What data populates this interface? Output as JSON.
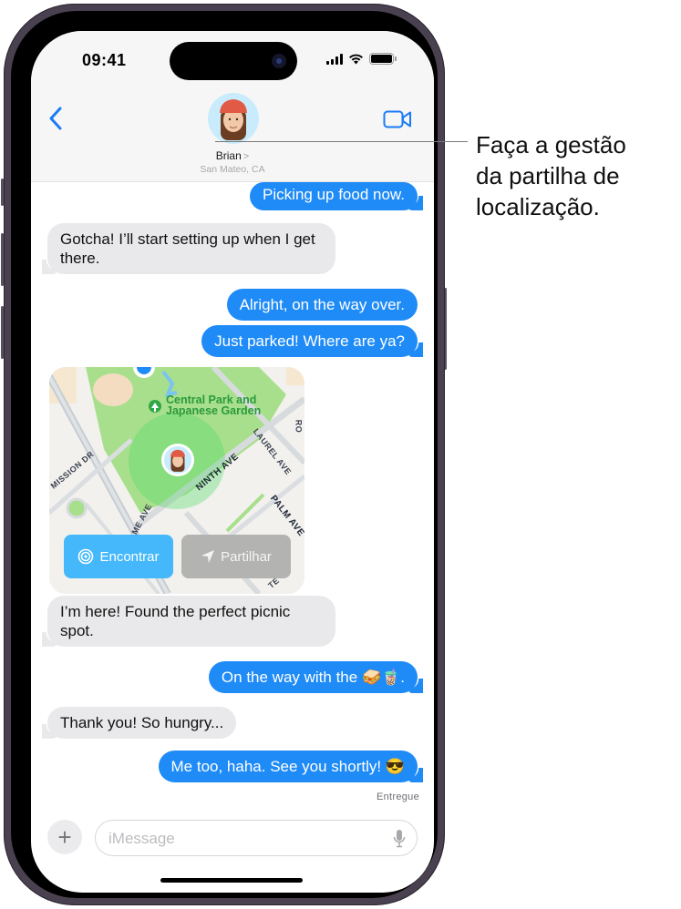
{
  "status_bar": {
    "time": "09:41",
    "icons": [
      "cellular-signal-icon",
      "wifi-icon",
      "battery-icon"
    ]
  },
  "header": {
    "back_icon": "chevron-left-icon",
    "contact_name": "Brian",
    "contact_chevron": ">",
    "contact_location": "San Mateo, CA",
    "video_icon": "facetime-video-icon"
  },
  "messages": [
    {
      "direction": "out",
      "text": "Picking up food now."
    },
    {
      "direction": "in",
      "text": "Gotcha! I’ll start setting up when I get there."
    },
    {
      "direction": "out",
      "text": "Alright, on the way over."
    },
    {
      "direction": "out",
      "text": "Just parked! Where are ya?"
    },
    {
      "direction": "in",
      "text": "I’m here! Found the perfect picnic spot."
    },
    {
      "direction": "out",
      "text": "On the way with the 🥪🧋."
    },
    {
      "direction": "in",
      "text": "Thank you! So hungry..."
    },
    {
      "direction": "out",
      "text": "Me too, haha. See you shortly! 😎"
    }
  ],
  "map_card": {
    "park_name_line1": "Central Park and",
    "park_name_line2": "Japanese Garden",
    "street_labels": [
      "MISSION DR",
      "NINTH AVE",
      "LAUREL AVE",
      "PALM AVE",
      "AME AVE",
      "RO",
      "TE"
    ],
    "find_button": "Encontrar",
    "share_button": "Partilhar"
  },
  "delivered_label": "Entregue",
  "composer": {
    "plus_label": "+",
    "placeholder": "iMessage"
  },
  "annotation": {
    "text_line1": "Faça a gestão",
    "text_line2": "da partilha de",
    "text_line3": "localização."
  },
  "colors": {
    "outgoing_bubble": "#1f8bf7",
    "incoming_bubble": "#e9e9eb",
    "accent": "#1a7cf5",
    "find_button": "#44b8fb",
    "share_button": "#b3b3b1"
  }
}
